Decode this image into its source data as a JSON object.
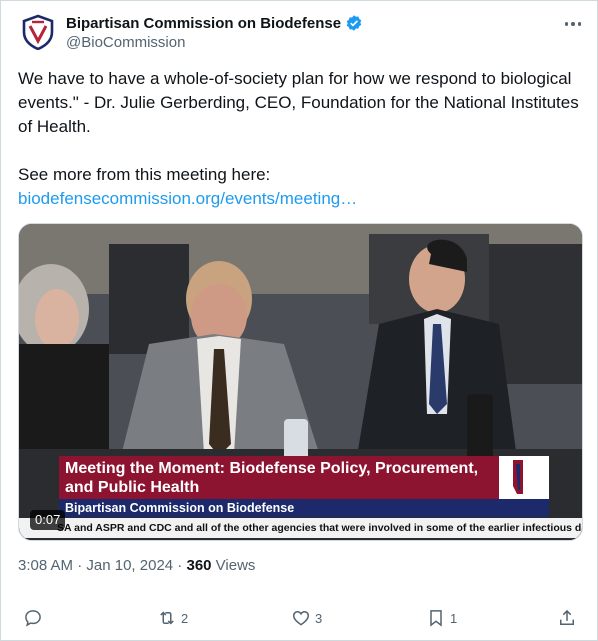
{
  "account": {
    "display_name": "Bipartisan Commission on Biodefense",
    "handle": "@BioCommission",
    "verified": true,
    "avatar_icon": "shield-logo-icon",
    "brand_colors": {
      "red": "#b5243a",
      "navy": "#1c2a6b"
    }
  },
  "tweet": {
    "text": "We have to have a whole-of-society plan for how we respond to biological events.\" - Dr. Julie Gerberding, CEO, Foundation for the National Institutes of Health.\n\nSee more from this meeting here: ",
    "link_text": "biodefensecommission.org/events/meeting…",
    "link_color": "#1d9bf0"
  },
  "video": {
    "title_line": "Meeting the Moment: Biodefense Policy, Procurement, and Public Health",
    "subtitle": "Bipartisan Commission on Biodefense",
    "ticker": "SA and ASPR and CDC and all of the other agencies that were involved in some of the earlier infectious di",
    "duration": "0:07",
    "title_bg": "#8c1431",
    "subtitle_bg": "#1c2a6b"
  },
  "meta": {
    "time": "3:08 AM",
    "separator": " · ",
    "date": "Jan 10, 2024",
    "views_count": "360",
    "views_label": " Views"
  },
  "actions": {
    "reply": {
      "icon": "reply-icon",
      "count": ""
    },
    "retweet": {
      "icon": "retweet-icon",
      "count": "2"
    },
    "like": {
      "icon": "heart-icon",
      "count": "3"
    },
    "bookmark": {
      "icon": "bookmark-icon",
      "count": "1"
    },
    "share": {
      "icon": "share-icon",
      "count": ""
    }
  },
  "more_icon": "more-options-icon"
}
